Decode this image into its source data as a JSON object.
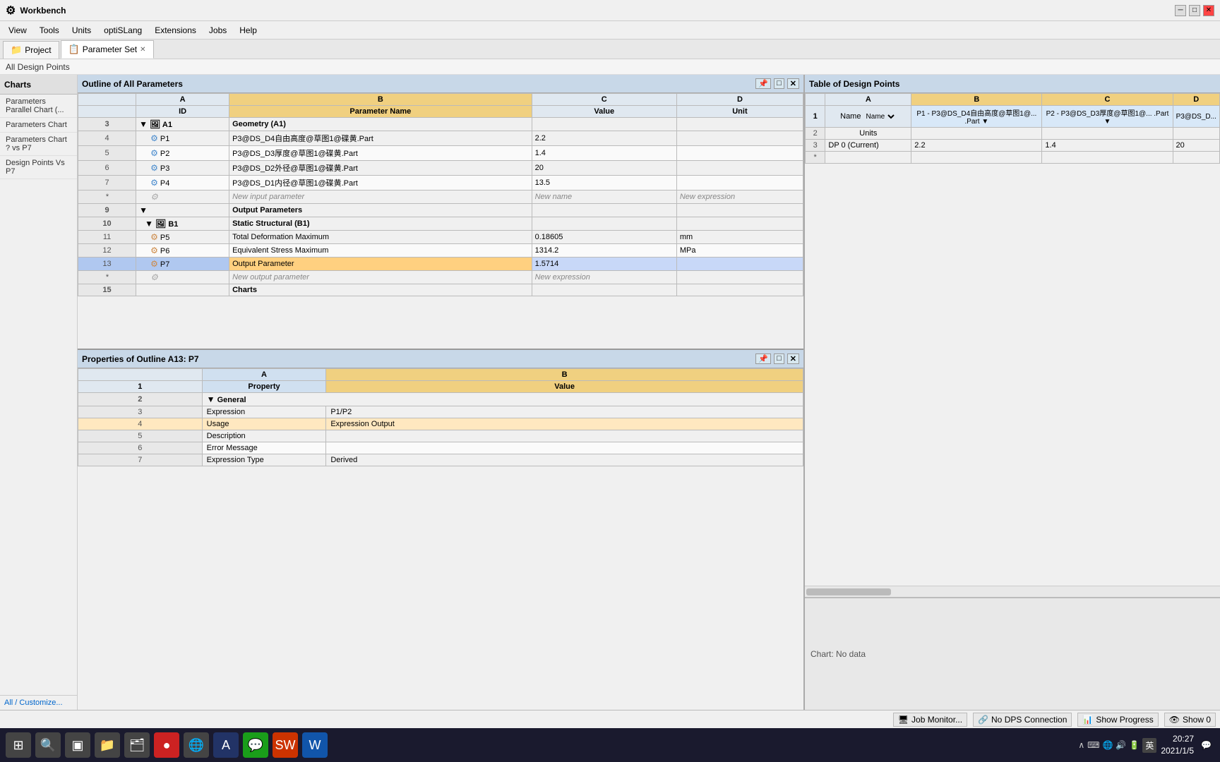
{
  "app": {
    "title": "Workbench",
    "tabs": [
      {
        "label": "Project",
        "icon": "project-icon",
        "active": false,
        "closable": false
      },
      {
        "label": "Parameter Set",
        "icon": "param-icon",
        "active": true,
        "closable": true
      }
    ],
    "breadcrumb": "All Design Points"
  },
  "menu": {
    "items": [
      "View",
      "Tools",
      "Units",
      "optiSLang",
      "Extensions",
      "Jobs",
      "Help"
    ]
  },
  "sidebar": {
    "header": "Charts",
    "items": [
      "Parameters Parallel Chart (...",
      "Parameters Chart",
      "Parameters Chart ? vs P7",
      "Design Points Vs  P7"
    ],
    "bottom_link": "All / Customize..."
  },
  "outline": {
    "title": "Outline of All Parameters",
    "columns": [
      "",
      "ID",
      "Parameter Name",
      "Value",
      "Unit"
    ],
    "rows": [
      {
        "num": "",
        "indent": 0,
        "type": "header",
        "id": "",
        "name": "A",
        "param": "B",
        "value": "C",
        "unit": "D"
      },
      {
        "num": "3",
        "indent": 1,
        "type": "group",
        "icon": "folder",
        "id": "A1",
        "name": "Geometry (A1)",
        "param": "",
        "value": "",
        "unit": ""
      },
      {
        "num": "4",
        "indent": 2,
        "type": "input",
        "icon": "param",
        "id": "P1",
        "name": "P3@DS_D4自由高度@草图1@碟黄.Part",
        "param": "",
        "value": "2.2",
        "unit": ""
      },
      {
        "num": "5",
        "indent": 2,
        "type": "input",
        "icon": "param",
        "id": "P2",
        "name": "P3@DS_D3厚度@草图1@碟黄.Part",
        "param": "",
        "value": "1.4",
        "unit": ""
      },
      {
        "num": "6",
        "indent": 2,
        "type": "input",
        "icon": "param",
        "id": "P3",
        "name": "P3@DS_D2外径@草图1@碟黄.Part",
        "param": "",
        "value": "20",
        "unit": ""
      },
      {
        "num": "7",
        "indent": 2,
        "type": "input",
        "icon": "param",
        "id": "P4",
        "name": "P3@DS_D1内径@草图1@碟黄.Part",
        "param": "",
        "value": "13.5",
        "unit": ""
      },
      {
        "num": "*",
        "indent": 2,
        "type": "new",
        "icon": "",
        "id": "",
        "name": "New input parameter",
        "param": "New name",
        "value": "New expression",
        "unit": ""
      },
      {
        "num": "9",
        "indent": 0,
        "type": "group_label",
        "icon": "",
        "id": "",
        "name": "Output Parameters",
        "param": "",
        "value": "",
        "unit": ""
      },
      {
        "num": "10",
        "indent": 1,
        "type": "group",
        "icon": "struct",
        "id": "B1",
        "name": "Static Structural (B1)",
        "param": "",
        "value": "",
        "unit": ""
      },
      {
        "num": "11",
        "indent": 2,
        "type": "output",
        "icon": "param",
        "id": "P5",
        "name": "Total Deformation Maximum",
        "param": "",
        "value": "0.18605",
        "unit": "mm"
      },
      {
        "num": "12",
        "indent": 2,
        "type": "output",
        "icon": "param",
        "id": "P6",
        "name": "Equivalent Stress Maximum",
        "param": "",
        "value": "1314.2",
        "unit": "MPa"
      },
      {
        "num": "13",
        "indent": 2,
        "type": "output_selected",
        "icon": "param",
        "id": "P7",
        "name": "Output Parameter",
        "param": "",
        "value": "1.5714",
        "unit": ""
      },
      {
        "num": "*",
        "indent": 2,
        "type": "new",
        "icon": "",
        "id": "",
        "name": "New output parameter",
        "param": "",
        "value": "New expression",
        "unit": ""
      },
      {
        "num": "15",
        "indent": 0,
        "type": "group_label",
        "icon": "",
        "id": "",
        "name": "Charts",
        "param": "",
        "value": "",
        "unit": ""
      }
    ]
  },
  "properties": {
    "title": "Properties of Outline A13: P7",
    "columns": [
      "",
      "A",
      "B"
    ],
    "col_headers": [
      "Property",
      "Value"
    ],
    "rows": [
      {
        "num": "2",
        "type": "group",
        "prop": "General",
        "value": ""
      },
      {
        "num": "3",
        "type": "data",
        "prop": "Expression",
        "value": "P1/P2"
      },
      {
        "num": "4",
        "type": "data_highlight",
        "prop": "Usage",
        "value": "Expression Output"
      },
      {
        "num": "5",
        "type": "data",
        "prop": "Description",
        "value": ""
      },
      {
        "num": "6",
        "type": "data",
        "prop": "Error Message",
        "value": ""
      },
      {
        "num": "7",
        "type": "data",
        "prop": "Expression Type",
        "value": "Derived"
      }
    ]
  },
  "design_table": {
    "title": "Table of Design Points",
    "col_headers": [
      "",
      "A",
      "B",
      "C",
      "D"
    ],
    "col_subheaders": {
      "A": "Name",
      "B": "P1 - P3@DS_D4自由高度@草图1@... .Part",
      "C": "P2 - P3@DS_D3厚度@草图1@... .Part",
      "D": "P3@DS_D..."
    },
    "rows": [
      {
        "num": "1",
        "type": "header_row"
      },
      {
        "num": "2",
        "a": "Units",
        "b": "",
        "c": "",
        "d": ""
      },
      {
        "num": "3",
        "a": "DP 0 (Current)",
        "b": "2.2",
        "c": "1.4",
        "d": "20"
      },
      {
        "num": "*",
        "a": "",
        "b": "",
        "c": "",
        "d": ""
      }
    ]
  },
  "chart_area": {
    "label": "Chart: No data"
  },
  "status_bar": {
    "items": [
      {
        "label": "Job Monitor...",
        "icon": "monitor-icon"
      },
      {
        "label": "No DPS Connection",
        "icon": "connection-icon"
      },
      {
        "label": "Show Progress",
        "icon": "progress-icon"
      },
      {
        "label": "Show 0",
        "icon": "show-icon"
      }
    ]
  },
  "taskbar": {
    "time": "20:27",
    "date": "2021/1/5",
    "lang": "英",
    "apps": [
      "search",
      "taskview",
      "explorer",
      "folder",
      "record",
      "browser",
      "wechat",
      "sw",
      "word"
    ]
  }
}
